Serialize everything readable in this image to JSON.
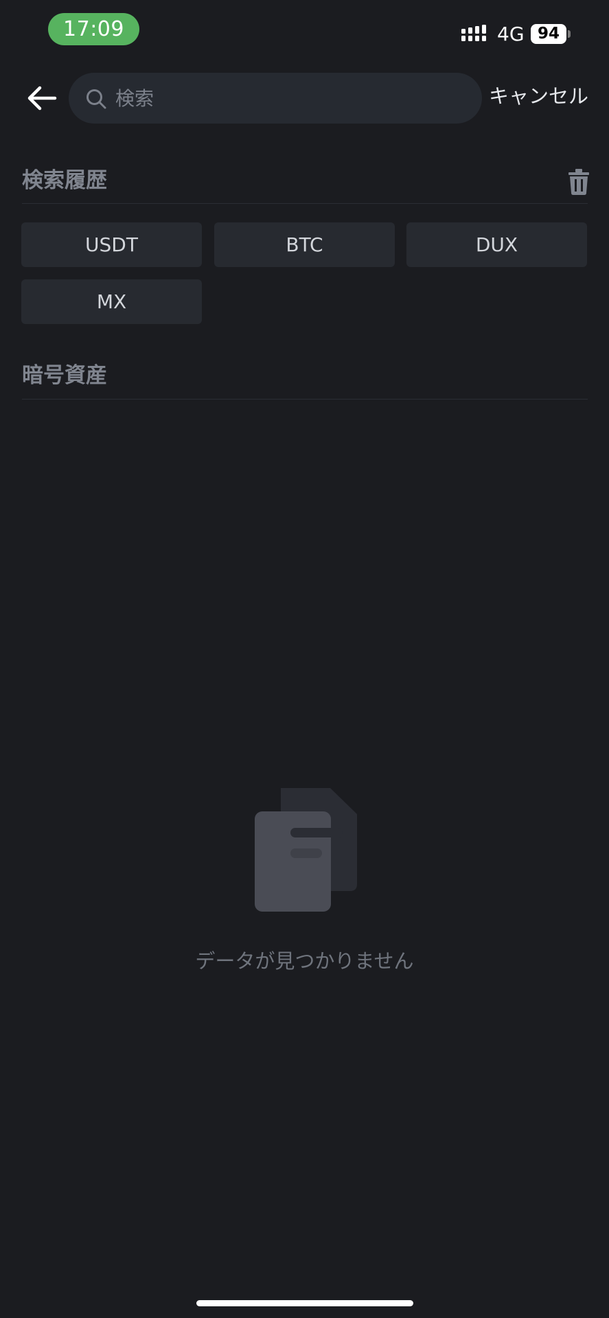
{
  "status_bar": {
    "time": "17:09",
    "network": "4G",
    "battery": "94"
  },
  "header": {
    "search_placeholder": "検索",
    "search_value": "",
    "cancel_label": "キャンセル"
  },
  "history": {
    "title": "検索履歴",
    "items": [
      "USDT",
      "BTC",
      "DUX",
      "MX"
    ]
  },
  "assets": {
    "title": "暗号資産"
  },
  "empty_state": {
    "message": "データが見つかりません"
  },
  "icons": {
    "back": "arrow-left-icon",
    "search": "search-icon",
    "trash": "trash-icon",
    "empty": "empty-documents-icon"
  },
  "colors": {
    "background": "#1b1c20",
    "surface": "#262a31",
    "status_pill": "#57b35f"
  }
}
